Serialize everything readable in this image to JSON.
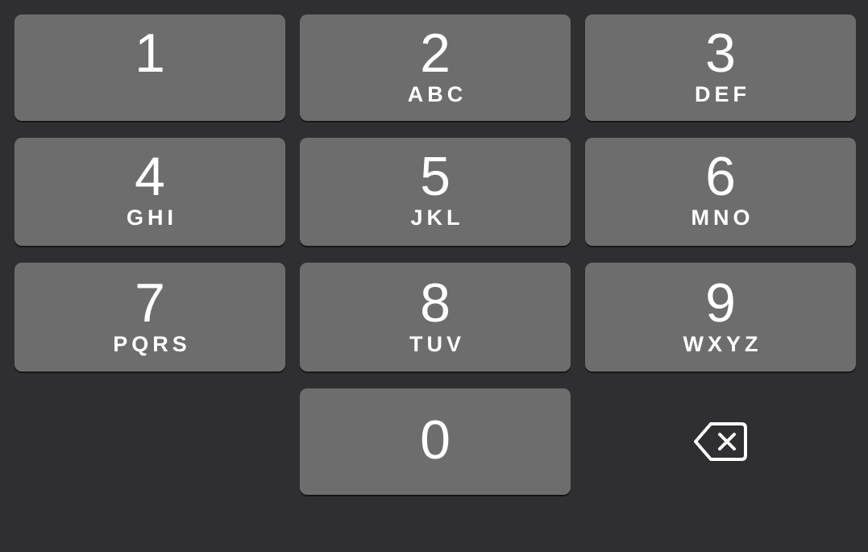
{
  "keypad": {
    "keys": [
      {
        "digit": "1",
        "letters": ""
      },
      {
        "digit": "2",
        "letters": "ABC"
      },
      {
        "digit": "3",
        "letters": "DEF"
      },
      {
        "digit": "4",
        "letters": "GHI"
      },
      {
        "digit": "5",
        "letters": "JKL"
      },
      {
        "digit": "6",
        "letters": "MNO"
      },
      {
        "digit": "7",
        "letters": "PQRS"
      },
      {
        "digit": "8",
        "letters": "TUV"
      },
      {
        "digit": "9",
        "letters": "WXYZ"
      },
      {
        "digit": "0",
        "letters": ""
      }
    ],
    "delete_icon": "delete-backspace-icon"
  },
  "colors": {
    "background": "#2f2f31",
    "key": "#6d6d6e",
    "text": "#ffffff"
  }
}
